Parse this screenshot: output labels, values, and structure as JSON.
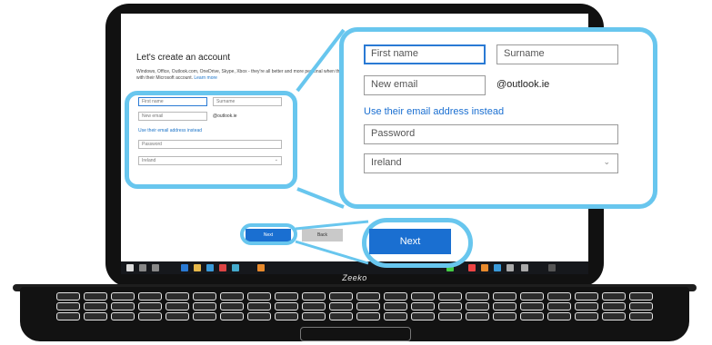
{
  "brand": "Zeeko",
  "colors": {
    "accent": "#1a6fd1",
    "highlight": "#68c6ee"
  },
  "dialog": {
    "title": "Let's create an account",
    "description": "Windows, Office, Outlook.com, OneDrive, Skype, Xbox - they're all better and more personal when they sign in with their Microsoft account.",
    "learn_more": "Learn more",
    "first_name_placeholder": "First name",
    "surname_placeholder": "Surname",
    "email_placeholder": "New email",
    "email_domain": "@outlook.ie",
    "use_existing_email": "Use their email address instead",
    "password_placeholder": "Password",
    "country_value": "Ireland",
    "next_label": "Next",
    "back_label": "Back"
  },
  "zoom": {
    "first_name_placeholder": "First name",
    "surname_placeholder": "Surname",
    "email_placeholder": "New email",
    "email_domain": "@outlook.ie",
    "use_existing_email": "Use their email address instead",
    "password_placeholder": "Password",
    "country_value": "Ireland",
    "chevron_icon": "chevron-down-icon"
  },
  "next_button_zoom": {
    "label": "Next"
  }
}
